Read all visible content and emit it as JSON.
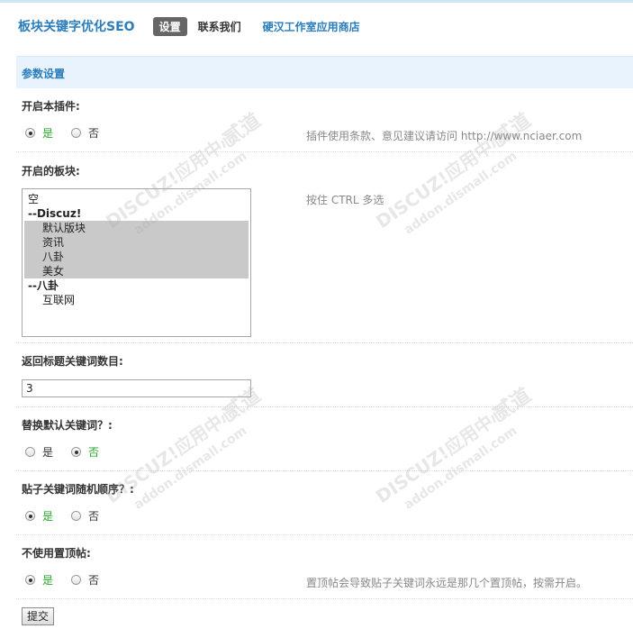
{
  "header": {
    "plugin_title": "板块关键字优化SEO",
    "nav": {
      "settings": "设置",
      "contact": "联系我们",
      "store": "硬汉工作室应用商店"
    }
  },
  "section": {
    "title": "参数设置"
  },
  "fields": {
    "enable_plugin": {
      "label": "开启本插件:",
      "options": {
        "yes": "是",
        "no": "否"
      },
      "selected": "是",
      "hint": "插件使用条款、意见建议请访问 http://www.nciaer.com"
    },
    "forums": {
      "label": "开启的板块:",
      "hint": "按住 CTRL 多选",
      "options": [
        {
          "label": "空",
          "selected": false
        },
        {
          "label": "--Discuz!",
          "selected": false
        },
        {
          "label": "默认版块",
          "selected": true
        },
        {
          "label": "资讯",
          "selected": true
        },
        {
          "label": "八卦",
          "selected": true
        },
        {
          "label": "美女",
          "selected": true
        },
        {
          "label": "--八卦",
          "selected": false
        },
        {
          "label": "互联网",
          "selected": false
        }
      ]
    },
    "keyword_count": {
      "label": "返回标题关键词数目:",
      "value": "3"
    },
    "replace_default": {
      "label": "替换默认关键词？:",
      "options": {
        "yes": "是",
        "no": "否"
      },
      "selected": "否"
    },
    "random_order": {
      "label": "贴子关键词随机顺序？:",
      "options": {
        "yes": "是",
        "no": "否"
      },
      "selected": "是"
    },
    "no_sticky": {
      "label": "不使用置顶帖:",
      "options": {
        "yes": "是",
        "no": "否"
      },
      "selected": "是",
      "hint": "置顶帖会导致贴子关键词永远是那几个置顶帖，按需开启。"
    }
  },
  "submit_label": "提交",
  "watermark": {
    "brand": "DISCUZ!应用中心",
    "site": "addon.dismall.com",
    "tag": "贰道",
    "color": "#c8c8c8"
  }
}
